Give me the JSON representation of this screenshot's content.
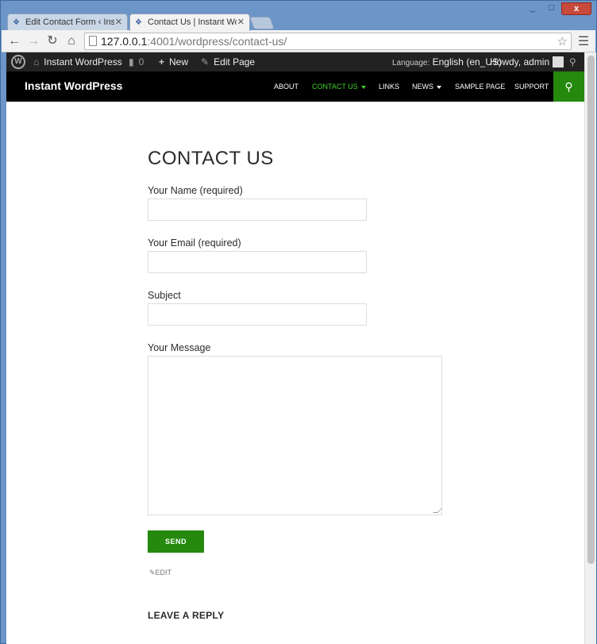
{
  "browser": {
    "tabs": [
      {
        "title": "Edit Contact Form ‹ Instan",
        "active": false
      },
      {
        "title": "Contact Us | Instant Word",
        "active": true
      }
    ],
    "url_host": "127.0.0.1",
    "url_path": ":4001/wordpress/contact-us/",
    "window_controls": {
      "minimize": "_",
      "maximize": "□",
      "close": "x"
    }
  },
  "adminbar": {
    "site_name": "Instant WordPress",
    "comments_count": "0",
    "new_label": "New",
    "edit_page_label": "Edit Page",
    "language_label": "Language:",
    "language_value": "English (en_US)",
    "howdy": "Howdy, admin"
  },
  "site": {
    "title": "Instant WordPress",
    "nav": [
      {
        "label": "ABOUT",
        "active": false,
        "has_dropdown": false
      },
      {
        "label": "CONTACT US",
        "active": true,
        "has_dropdown": true
      },
      {
        "label": "LINKS",
        "active": false,
        "has_dropdown": false
      },
      {
        "label": "NEWS",
        "active": false,
        "has_dropdown": true
      },
      {
        "label": "SAMPLE PAGE",
        "active": false,
        "has_dropdown": false
      },
      {
        "label": "SUPPORT",
        "active": false,
        "has_dropdown": false
      }
    ],
    "accent_color": "#24890d",
    "active_nav_color": "#41d02c"
  },
  "content": {
    "heading": "CONTACT US",
    "form": {
      "name_label": "Your Name (required)",
      "name_value": "",
      "email_label": "Your Email (required)",
      "email_value": "",
      "subject_label": "Subject",
      "subject_value": "",
      "message_label": "Your Message",
      "message_value": "",
      "send_label": "SEND"
    },
    "edit_label": "EDIT",
    "reply_heading": "LEAVE A REPLY"
  }
}
